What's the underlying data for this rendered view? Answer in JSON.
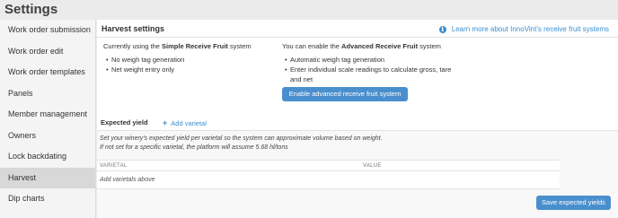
{
  "page": {
    "title": "Settings"
  },
  "sidebar": {
    "items": [
      {
        "label": "Work order submission",
        "active": false
      },
      {
        "label": "Work order edit",
        "active": false
      },
      {
        "label": "Work order templates",
        "active": false
      },
      {
        "label": "Panels",
        "active": false
      },
      {
        "label": "Member management",
        "active": false
      },
      {
        "label": "Owners",
        "active": false
      },
      {
        "label": "Lock backdating",
        "active": false
      },
      {
        "label": "Harvest",
        "active": true
      },
      {
        "label": "Dip charts",
        "active": false
      }
    ]
  },
  "harvest": {
    "title": "Harvest settings",
    "learn_more": "Learn more about InnoVint's receive fruit systems",
    "simple": {
      "prefix": "Currently using the ",
      "name": "Simple Receive Fruit",
      "suffix": " system",
      "features": [
        "No weigh tag generation",
        "Net weight entry only"
      ]
    },
    "advanced": {
      "prefix": "You can enable the ",
      "name": "Advanced Receive Fruit",
      "suffix": " system",
      "features": [
        "Automatic weigh tag generation",
        "Enter individual scale readings to calculate gross, tare and net"
      ],
      "enable_label": "Enable advanced receive fruit system"
    },
    "expected_yield": {
      "title": "Expected yield",
      "add_label": "Add varietal",
      "description_line1": "Set your winery's expected yield per varietal so the system can approximate volume based on weight.",
      "description_line2": "If not set for a specific varietal, the platform will assume 5.68 hl/tons",
      "columns": [
        "VARIETAL",
        "VALUE"
      ],
      "empty_text": "Add varietals above",
      "save_label": "Save expected yields"
    }
  },
  "colors": {
    "accent": "#3a8fd1",
    "button": "#4a8fcd",
    "active_sidebar": "#d8d8d8"
  }
}
